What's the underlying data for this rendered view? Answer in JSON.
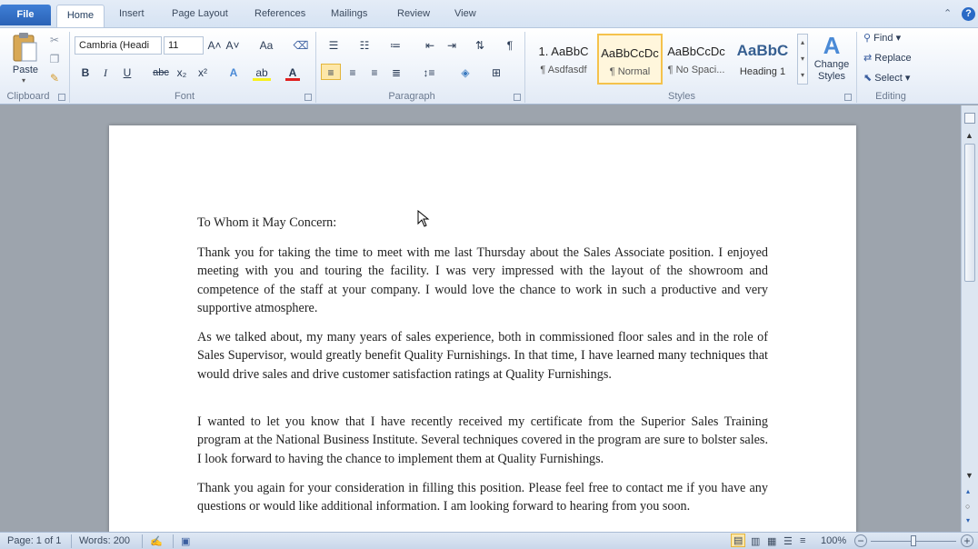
{
  "tabs": {
    "file": "File",
    "home": "Home",
    "insert": "Insert",
    "page_layout": "Page Layout",
    "references": "References",
    "mailings": "Mailings",
    "review": "Review",
    "view": "View"
  },
  "ribbon": {
    "clipboard": {
      "paste": "Paste",
      "label": "Clipboard"
    },
    "font": {
      "name": "Cambria (Headi",
      "size": "11",
      "label": "Font",
      "bold": "B",
      "italic": "I",
      "underline": "U",
      "strike": "abc",
      "sub": "x₂",
      "sup": "x²",
      "grow": "A˄",
      "shrink": "A˅",
      "change_case": "Aa"
    },
    "paragraph": {
      "label": "Paragraph",
      "pilcrow": "¶"
    },
    "styles": {
      "label": "Styles",
      "items": [
        {
          "preview": "1. AaBbC",
          "name": "¶ Asdfasdf"
        },
        {
          "preview": "AaBbCcDc",
          "name": "¶ Normal"
        },
        {
          "preview": "AaBbCcDc",
          "name": "¶ No Spaci..."
        },
        {
          "preview": "AaBbC",
          "name": "Heading 1"
        }
      ],
      "change": "Change Styles"
    },
    "editing": {
      "label": "Editing",
      "find": "Find",
      "replace": "Replace",
      "select": "Select"
    }
  },
  "document": {
    "salutation": "To Whom it May Concern:",
    "paragraphs": [
      "Thank you for taking the time to meet with me last Thursday about the Sales Associate position. I enjoyed meeting with you and touring the facility. I was very impressed with the layout of the showroom and competence of the staff at your company. I would love the chance to work in such a productive and very supportive atmosphere.",
      "As we talked about, my many years of sales experience, both in commissioned floor sales and in the role of Sales Supervisor, would greatly benefit Quality Furnishings. In that time, I have learned many techniques that would drive sales and drive customer satisfaction ratings at Quality Furnishings.",
      "I wanted to let you know that I have recently received my certificate from the Superior Sales Training program at the National Business Institute. Several techniques covered in the program are sure to bolster sales. I look forward to having the chance to implement them at Quality Furnishings.",
      "Thank you again for your consideration in filling this position. Please feel free to contact me if you have any questions or would like additional information. I am looking forward to hearing from you soon."
    ]
  },
  "status": {
    "page": "Page: 1 of 1",
    "words": "Words: 200",
    "zoom": "100%"
  },
  "colors": {
    "accent": "#2a62b6",
    "ribbon": "#eef3fa",
    "workspace": "#9da4ad"
  }
}
